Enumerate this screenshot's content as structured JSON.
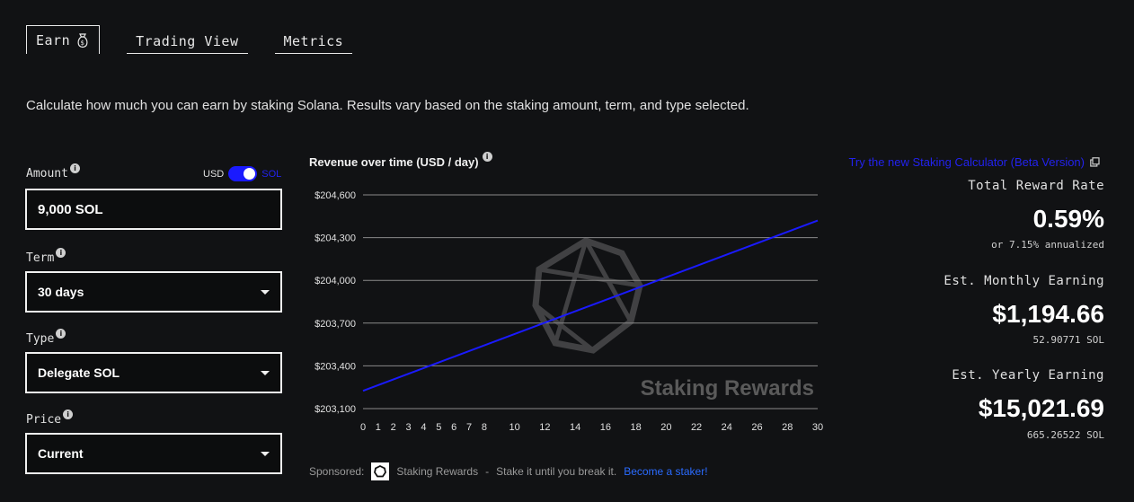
{
  "tabs": {
    "earn": "Earn",
    "trading_view": "Trading View",
    "metrics": "Metrics"
  },
  "description": "Calculate how much you can earn by staking Solana. Results vary based on the staking amount, term, and type selected.",
  "form": {
    "amount_label": "Amount",
    "amount_value": "9,000 SOL",
    "toggle_left": "USD",
    "toggle_right": "SOL",
    "term_label": "Term",
    "term_value": "30 days",
    "type_label": "Type",
    "type_value": "Delegate SOL",
    "price_label": "Price",
    "price_value": "Current"
  },
  "chart_data": {
    "type": "line",
    "title": "Revenue over time (USD / day)",
    "watermark": "Staking Rewards",
    "ylim": [
      203100,
      204600
    ],
    "xlim": [
      0,
      30
    ],
    "y_ticks": [
      203100,
      203400,
      203700,
      204000,
      204300,
      204600
    ],
    "y_tick_labels": [
      "$203,100",
      "$203,400",
      "$203,700",
      "$204,000",
      "$204,300",
      "$204,600"
    ],
    "x_ticks": [
      0,
      1,
      2,
      3,
      4,
      5,
      6,
      7,
      8,
      10,
      12,
      14,
      16,
      18,
      20,
      22,
      24,
      26,
      28,
      30
    ],
    "x_tick_labels": [
      "0",
      "1",
      "2",
      "3",
      "4",
      "5",
      "6",
      "7",
      "8",
      "10",
      "12",
      "14",
      "16",
      "18",
      "20",
      "22",
      "24",
      "26",
      "28",
      "30"
    ],
    "grid": true,
    "series": [
      {
        "x": [
          0,
          30
        ],
        "y": [
          203225,
          204420
        ]
      }
    ],
    "line_color": "#1a1aff"
  },
  "sponsor": {
    "label": "Sponsored:",
    "name": "Staking Rewards",
    "separator": "-",
    "tagline": "Stake it until you break it.",
    "cta": "Become a staker!"
  },
  "results": {
    "beta_link": "Try the new Staking Calculator (Beta Version)",
    "reward_rate_label": "Total Reward Rate",
    "reward_rate_value": "0.59%",
    "annualized": "or 7.15% annualized",
    "monthly_label": "Est. Monthly Earning",
    "monthly_usd": "$1,194.66",
    "monthly_sol": "52.90771 SOL",
    "yearly_label": "Est. Yearly Earning",
    "yearly_usd": "$15,021.69",
    "yearly_sol": "665.26522 SOL"
  },
  "colors": {
    "accent": "#1a1aff",
    "link": "#2a6bff",
    "background": "#111214"
  }
}
